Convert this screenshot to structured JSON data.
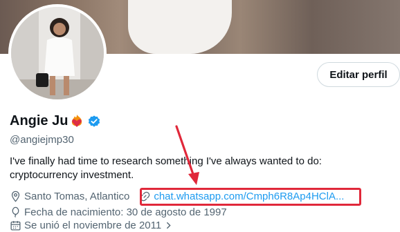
{
  "profile": {
    "name": "Angie Ju",
    "handle": "@angiejmp30",
    "bio": "I've finally had time to research something I've always wanted to do: cryptocurrency investment.",
    "location": "Santo Tomas, Atlantico",
    "website": "chat.whatsapp.com/Cmph6R8Ap4HClA...",
    "birthday": "Fecha de nacimiento: 30 de agosto de 1997",
    "joined": "Se unió el noviembre de 2011"
  },
  "actions": {
    "edit_profile": "Editar perfil"
  },
  "icons": {
    "verified": "verified-badge-icon",
    "emoji": "heart-on-fire-emoji",
    "location": "location-pin-icon",
    "link": "link-icon",
    "birthday": "balloon-icon",
    "calendar": "calendar-icon"
  },
  "colors": {
    "accent": "#1d9bf0",
    "annotation": "#e0283a",
    "muted": "#536471"
  }
}
